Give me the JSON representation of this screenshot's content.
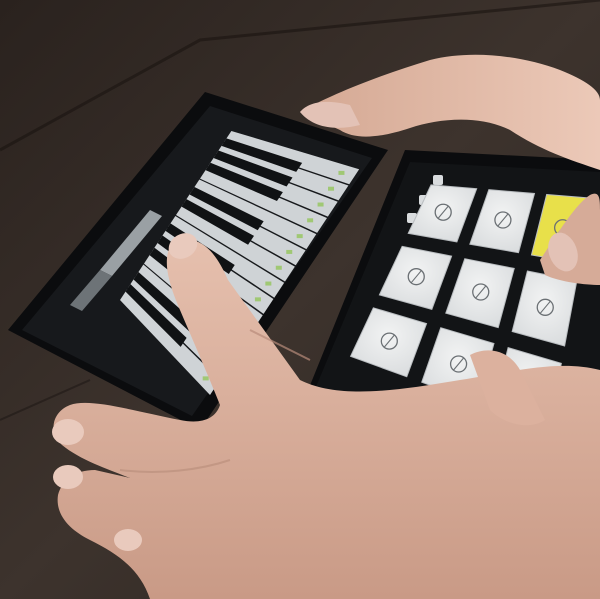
{
  "scene": {
    "description_type": "photo",
    "colors": {
      "table": "#3a302a",
      "table_dark": "#241d19",
      "table_seam": "#1a1411",
      "phone_body": "#0b0c0e",
      "screen_dark": "#17191c",
      "white_key": "#cfd3d6",
      "black_key": "#101214",
      "pad": "#e6e8e9",
      "pad_shadow": "#b9bdc0",
      "pad_active": "#e8e04a",
      "skin": "#d8ad98",
      "skin_shadow": "#b88c7a",
      "skin_light": "#e9c6b5",
      "nail": "#e3c2b6",
      "key_dot": "#8bc34a"
    }
  },
  "piano_app": {
    "white_keys_visible": 14,
    "key_markers": [
      "",
      "",
      "",
      "",
      "",
      "",
      "",
      "",
      "",
      "",
      "",
      "",
      "",
      ""
    ]
  },
  "drum_app": {
    "pads": [
      {
        "icon": "hi-hat-icon",
        "active": false
      },
      {
        "icon": "snare-drum-icon",
        "active": false
      },
      {
        "icon": "crash-cymbal-icon",
        "active": true
      },
      {
        "icon": "maraca-icon",
        "active": false
      },
      {
        "icon": "tom-drum-icon",
        "active": false
      },
      {
        "icon": "ride-cymbal-icon",
        "active": false
      },
      {
        "icon": "tambourine-icon",
        "active": false
      },
      {
        "icon": "floor-tom-icon",
        "active": false
      },
      {
        "icon": "kick-drum-icon",
        "active": false
      }
    ],
    "side_icons": [
      "grid-icon",
      "drum-kit-icon",
      "settings-icon",
      "dice-icon",
      "back-icon"
    ]
  }
}
